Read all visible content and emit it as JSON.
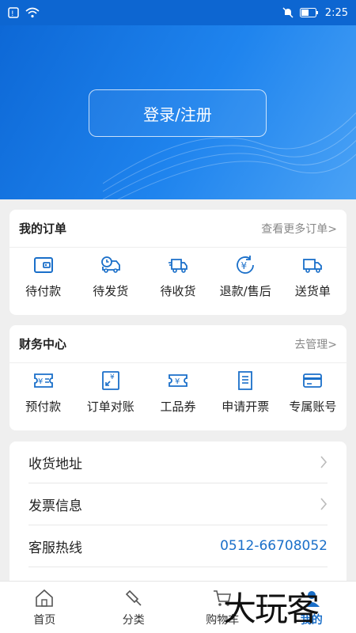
{
  "status_bar": {
    "time": "2:25"
  },
  "hero": {
    "login_label": "登录/注册"
  },
  "orders": {
    "title": "我的订单",
    "more": "查看更多订单>",
    "items": [
      {
        "label": "待付款",
        "icon": "wallet-icon"
      },
      {
        "label": "待发货",
        "icon": "truck-clock-icon"
      },
      {
        "label": "待收货",
        "icon": "delivery-truck-icon"
      },
      {
        "label": "退款/售后",
        "icon": "yen-refund-icon"
      },
      {
        "label": "送货单",
        "icon": "truck-icon"
      }
    ]
  },
  "finance": {
    "title": "财务中心",
    "more": "去管理>",
    "items": [
      {
        "label": "预付款",
        "icon": "prepay-ticket-icon"
      },
      {
        "label": "订单对账",
        "icon": "reconcile-icon"
      },
      {
        "label": "工品券",
        "icon": "coupon-icon"
      },
      {
        "label": "申请开票",
        "icon": "invoice-icon"
      },
      {
        "label": "专属账号",
        "icon": "card-icon"
      }
    ]
  },
  "list": [
    {
      "label": "收货地址"
    },
    {
      "label": "发票信息"
    },
    {
      "label": "客服热线",
      "value": "0512-66708052"
    }
  ],
  "tabs": [
    {
      "label": "首页",
      "icon": "home-icon"
    },
    {
      "label": "分类",
      "icon": "category-icon"
    },
    {
      "label": "购物车",
      "icon": "cart-icon"
    },
    {
      "label": "我的",
      "icon": "profile-icon"
    }
  ],
  "watermark": "大玩客",
  "colors": {
    "accent": "#1a6fc9",
    "hero": "#1576e2"
  }
}
